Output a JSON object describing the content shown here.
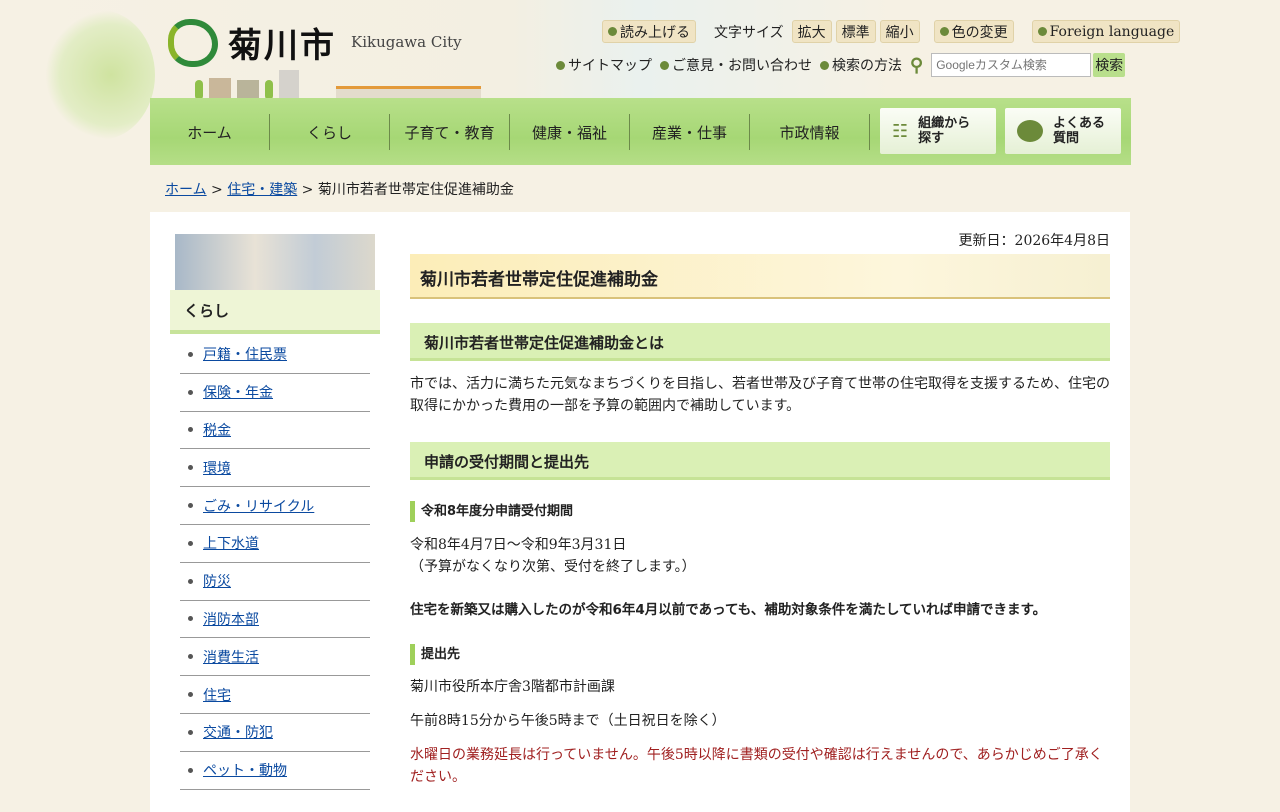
{
  "header": {
    "logo_text": "菊川市",
    "logo_en": "Kikugawa City",
    "toolbar": {
      "read_aloud": "読み上げる",
      "font_size_label": "文字サイズ",
      "font_large": "拡大",
      "font_standard": "標準",
      "font_small": "縮小",
      "color_change": "色の変更",
      "foreign_language": "Foreign language"
    },
    "links": {
      "sitemap": "サイトマップ",
      "contact": "ご意見・お問い合わせ",
      "search_help": "検索の方法"
    },
    "search": {
      "placeholder": "Googleカスタム検索",
      "button": "検索"
    }
  },
  "nav": {
    "items": [
      "ホーム",
      "くらし",
      "子育て・教育",
      "健康・福祉",
      "産業・仕事",
      "市政情報"
    ],
    "org_search": "組織から探す",
    "faq": "よくある質問"
  },
  "breadcrumb": {
    "home": "ホーム",
    "parent": "住宅・建築",
    "current": "菊川市若者世帯定住促進補助金"
  },
  "sidebar": {
    "title": "くらし",
    "items": [
      "戸籍・住民票",
      "保険・年金",
      "税金",
      "環境",
      "ごみ・リサイクル",
      "上下水道",
      "防災",
      "消防本部",
      "消費生活",
      "住宅",
      "交通・防犯",
      "ペット・動物"
    ]
  },
  "main": {
    "updated": "更新日：2026年4月8日",
    "title": "菊川市若者世帯定住促進補助金",
    "section1": {
      "heading": "菊川市若者世帯定住促進補助金とは",
      "body": "市では、活力に満ちた元気なまちづくりを目指し、若者世帯及び子育て世帯の住宅取得を支援するため、住宅の取得にかかった費用の一部を予算の範囲内で補助しています。"
    },
    "section2": {
      "heading": "申請の受付期間と提出先",
      "period_heading": "令和8年度分申請受付期間",
      "period": "令和8年4月7日～令和9年3月31日",
      "period_note": "（予算がなくなり次第、受付を終了します。）",
      "notice": "住宅を新築又は購入したのが令和6年4月以前であっても、補助対象条件を満たしていれば申請できます。",
      "submit_heading": "提出先",
      "submit_to": "菊川市役所本庁舎3階都市計画課",
      "hours": "午前8時15分から午後5時まで（土日祝日を除く）",
      "warning": "水曜日の業務延長は行っていません。午後5時以降に書類の受付や確認は行えませんので、あらかじめご了承ください。"
    }
  }
}
